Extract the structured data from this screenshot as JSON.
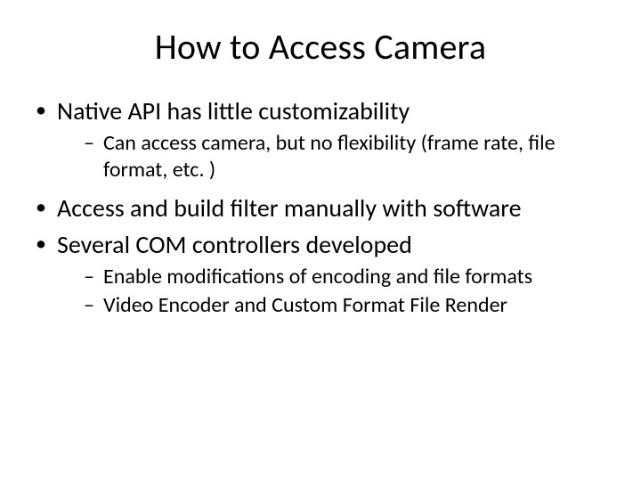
{
  "title": "How to Access Camera",
  "bullets": [
    {
      "text": "Native API has little customizability",
      "sub": [
        "Can access camera, but no flexibility (frame rate, file format, etc. )"
      ]
    },
    {
      "text": "Access and build filter manually with software",
      "sub": []
    },
    {
      "text": "Several COM controllers developed",
      "sub": [
        "Enable modifications of encoding and file formats",
        "Video Encoder and Custom Format File Render"
      ]
    }
  ]
}
